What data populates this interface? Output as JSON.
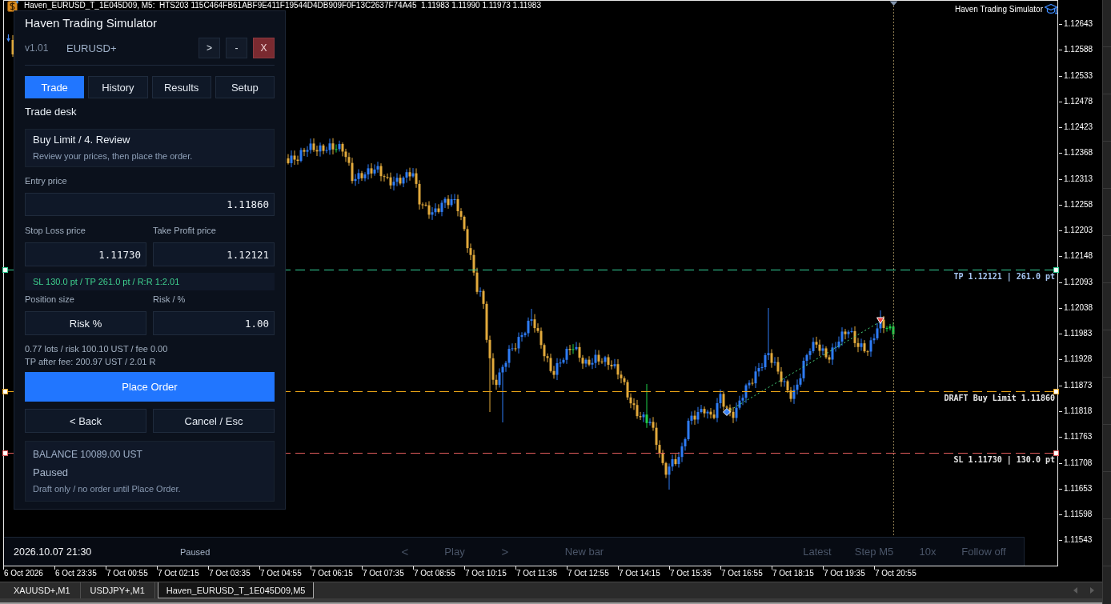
{
  "chart": {
    "title": "Haven_EURUSD_T_1E045D09, M5:  HTS203 115C464FB61ABF9E411F19544D4DB909F0F13C2637F74A45  1.11983 1.11990 1.11973 1.11983",
    "brand": "Haven Trading Simulator",
    "price_axis": [
      "1.12643",
      "1.12588",
      "1.12533",
      "1.12478",
      "1.12423",
      "1.12368",
      "1.12313",
      "1.12258",
      "1.12203",
      "1.12148",
      "1.12093",
      "1.12038",
      "1.11983",
      "1.11928",
      "1.11873",
      "1.11818",
      "1.11763",
      "1.11708",
      "1.11653",
      "1.11598",
      "1.11543"
    ],
    "time_axis": [
      "6 Oct 2026",
      "6 Oct 23:35",
      "7 Oct 00:55",
      "7 Oct 02:15",
      "7 Oct 03:35",
      "7 Oct 04:55",
      "7 Oct 06:15",
      "7 Oct 07:35",
      "7 Oct 08:55",
      "7 Oct 10:15",
      "7 Oct 11:35",
      "7 Oct 12:55",
      "7 Oct 14:15",
      "7 Oct 15:35",
      "7 Oct 16:55",
      "7 Oct 18:15",
      "7 Oct 19:35",
      "7 Oct 20:55"
    ],
    "price_lines": [
      {
        "kind": "take_profit",
        "label": "TP 1.12121 | 261.0 pt",
        "color": "#34d399"
      },
      {
        "kind": "order",
        "label": "DRAFT Buy Limit 1.11860",
        "color": "#e8a317"
      },
      {
        "kind": "stop_loss",
        "label": "SL 1.11730 | 130.0 pt",
        "color": "#e25c5c"
      }
    ]
  },
  "panel": {
    "title": "Haven Trading Simulator",
    "version": "v1.01",
    "symbol": "EURUSD+",
    "window_buttons": [
      {
        "kind": "collapse",
        "label": ">"
      },
      {
        "kind": "minimize",
        "label": "-"
      },
      {
        "kind": "close",
        "label": "X"
      }
    ],
    "tabs": [
      {
        "label": "Trade",
        "selected": true
      },
      {
        "label": "History",
        "selected": false
      },
      {
        "label": "Results",
        "selected": false
      },
      {
        "label": "Setup",
        "selected": false
      }
    ],
    "section_title": "Trade desk",
    "step_card": {
      "title": "Buy Limit / 4. Review",
      "hint": "Review your prices, then place the order."
    },
    "entry": {
      "label": "Entry price",
      "value": "1.11860"
    },
    "stop_loss": {
      "label": "Stop Loss price",
      "value": "1.11730"
    },
    "take_profit": {
      "label": "Take Profit price",
      "value": "1.12121"
    },
    "summary": "SL 130.0 pt / TP 261.0 pt / R:R 1:2.01",
    "position_size": {
      "label": "Position size",
      "value": "Risk %"
    },
    "risk": {
      "label": "Risk / %",
      "value": "1.00"
    },
    "details": [
      "0.77 lots / risk 100.10 UST / fee 0.00",
      "TP after fee: 200.97 UST / 2.01 R"
    ],
    "primary_button": "Place Order",
    "secondary_buttons": [
      "< Back",
      "Cancel / Esc"
    ],
    "status_card": {
      "balance": "BALANCE 10089.00 UST",
      "state": "Paused",
      "note": "Draft only / no order until Place Order."
    }
  },
  "playback_bar": {
    "time": "2026.10.07 21:30",
    "state": "Paused",
    "controls": [
      {
        "label": "<",
        "disabled": true
      },
      {
        "label": "Play",
        "disabled": true
      },
      {
        "label": ">",
        "disabled": true
      },
      {
        "label": "New bar",
        "disabled": true
      },
      {
        "label": "Latest",
        "disabled": true
      },
      {
        "label": "Step M5",
        "disabled": true
      },
      {
        "label": "10x",
        "disabled": true
      },
      {
        "label": "Follow off",
        "disabled": true
      }
    ]
  },
  "chart_tabs": [
    {
      "label": "XAUUSD+,M1",
      "selected": false
    },
    {
      "label": "USDJPY+,M1",
      "selected": false
    },
    {
      "label": "Haven_EURUSD_T_1E045D09,M5",
      "selected": true
    }
  ]
}
